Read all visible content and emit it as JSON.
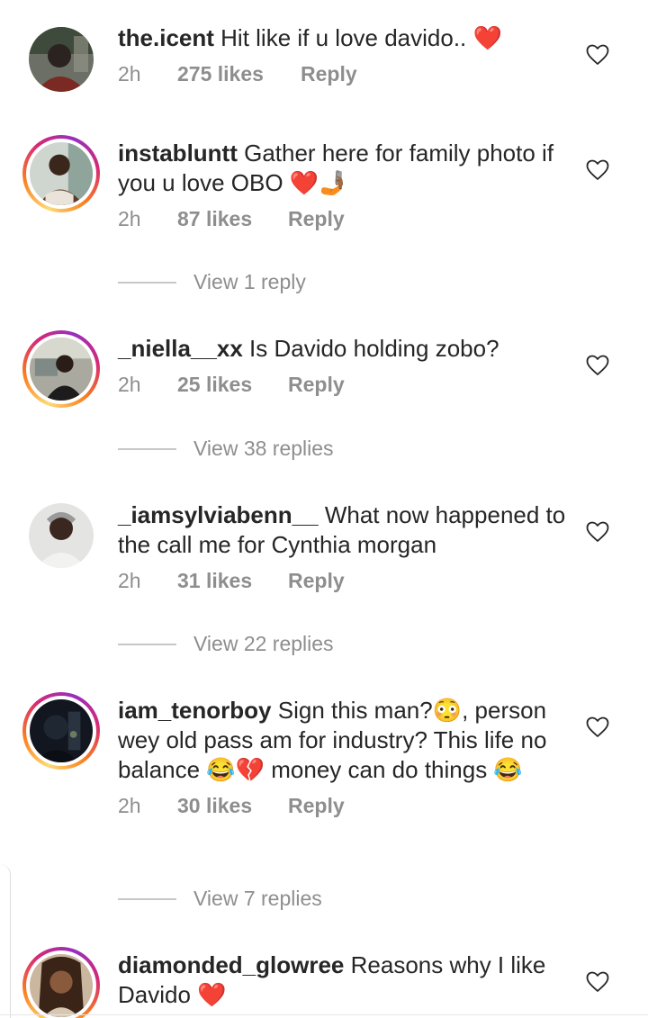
{
  "comments": [
    {
      "username": "the.icent",
      "text": "Hit like if u love davido.. ❤️",
      "time": "2h",
      "likes": "275 likes",
      "reply_label": "Reply"
    },
    {
      "username": "instabluntt",
      "text": "Gather here for family photo if you u love OBO ❤️🤳🏾",
      "time": "2h",
      "likes": "87 likes",
      "reply_label": "Reply",
      "view_replies": "View 1 reply"
    },
    {
      "username": "_niella__xx",
      "text": "Is Davido holding zobo?",
      "time": "2h",
      "likes": "25 likes",
      "reply_label": "Reply",
      "view_replies": "View 38 replies"
    },
    {
      "username": "_iamsylviabenn__",
      "text": "What now happened to the call me for Cynthia morgan",
      "time": "2h",
      "likes": "31 likes",
      "reply_label": "Reply",
      "view_replies": "View 22 replies"
    },
    {
      "username": "iam_tenorboy",
      "text": "Sign this man?😳, person wey old pass am for industry? This life no balance 😂💔 money can do things 😂",
      "time": "2h",
      "likes": "30 likes",
      "reply_label": "Reply",
      "view_replies": "View 7 replies"
    },
    {
      "username": "diamonded_glowree",
      "text": "Reasons why I like Davido ❤️"
    }
  ],
  "icons": {
    "like": "heart-outline-icon"
  },
  "colors": {
    "text": "#262626",
    "secondary": "#8e8e8e",
    "story_ring": [
      "#feda75",
      "#fa7e1e",
      "#d62976",
      "#962fbf"
    ]
  }
}
